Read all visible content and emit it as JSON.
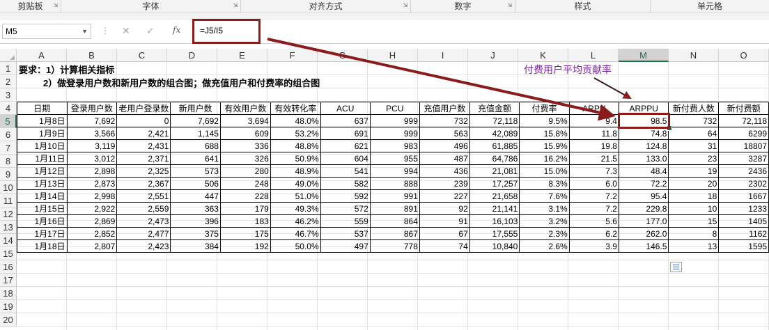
{
  "ribbon": {
    "groups": [
      "剪贴板",
      "字体",
      "对齐方式",
      "数字",
      "样式",
      "单元格"
    ]
  },
  "formula_bar": {
    "name_box": "M5",
    "fx_label": "fx",
    "formula": "=J5/I5"
  },
  "columns": [
    "A",
    "B",
    "C",
    "D",
    "E",
    "F",
    "G",
    "H",
    "I",
    "J",
    "K",
    "L",
    "M",
    "N",
    "O"
  ],
  "selected_column": "M",
  "rows": [
    "1",
    "2",
    "3",
    "4",
    "5",
    "6",
    "7",
    "8",
    "9",
    "10",
    "11",
    "12",
    "13",
    "14",
    "15",
    "16",
    "17",
    "18",
    "19",
    "20"
  ],
  "selected_row": "5",
  "sheet": {
    "line1": "要求：1）计算相关指标",
    "line2": "2）做登录用户数和新用户数的组合图；做充值用户和付费率的组合图",
    "headers": [
      "日期",
      "登录用户数",
      "老用户登录数",
      "新用户数",
      "有效用户数",
      "有效转化率",
      "ACU",
      "PCU",
      "充值用户数",
      "充值金额",
      "付费率",
      "ARPU",
      "ARPPU",
      "新付费人数",
      "新付费额"
    ],
    "rows": [
      [
        "1月8日",
        "7,692",
        "0",
        "7,692",
        "3,694",
        "48.0%",
        "637",
        "999",
        "732",
        "72,118",
        "9.5%",
        "9.4",
        "98.5",
        "732",
        "72,118"
      ],
      [
        "1月9日",
        "3,566",
        "2,421",
        "1,145",
        "609",
        "53.2%",
        "691",
        "999",
        "563",
        "42,089",
        "15.8%",
        "11.8",
        "74.8",
        "64",
        "6299"
      ],
      [
        "1月10日",
        "3,119",
        "2,431",
        "688",
        "336",
        "48.8%",
        "621",
        "983",
        "496",
        "61,885",
        "15.9%",
        "19.8",
        "124.8",
        "31",
        "18807"
      ],
      [
        "1月11日",
        "3,012",
        "2,371",
        "641",
        "326",
        "50.9%",
        "604",
        "955",
        "487",
        "64,786",
        "16.2%",
        "21.5",
        "133.0",
        "23",
        "3287"
      ],
      [
        "1月12日",
        "2,898",
        "2,325",
        "573",
        "280",
        "48.9%",
        "541",
        "994",
        "436",
        "21,081",
        "15.0%",
        "7.3",
        "48.4",
        "19",
        "2436"
      ],
      [
        "1月13日",
        "2,873",
        "2,367",
        "506",
        "248",
        "49.0%",
        "582",
        "888",
        "239",
        "17,257",
        "8.3%",
        "6.0",
        "72.2",
        "20",
        "2302"
      ],
      [
        "1月14日",
        "2,998",
        "2,551",
        "447",
        "228",
        "51.0%",
        "592",
        "991",
        "227",
        "21,658",
        "7.6%",
        "7.2",
        "95.4",
        "18",
        "1667"
      ],
      [
        "1月15日",
        "2,922",
        "2,559",
        "363",
        "179",
        "49.3%",
        "572",
        "891",
        "92",
        "21,141",
        "3.1%",
        "7.2",
        "229.8",
        "10",
        "1233"
      ],
      [
        "1月16日",
        "2,869",
        "2,473",
        "396",
        "183",
        "46.2%",
        "559",
        "864",
        "91",
        "16,103",
        "3.2%",
        "5.6",
        "177.0",
        "15",
        "1405"
      ],
      [
        "1月17日",
        "2,852",
        "2,477",
        "375",
        "175",
        "46.7%",
        "537",
        "867",
        "67",
        "17,555",
        "2.3%",
        "6.2",
        "262.0",
        "8",
        "1162"
      ],
      [
        "1月18日",
        "2,807",
        "2,423",
        "384",
        "192",
        "50.0%",
        "497",
        "778",
        "74",
        "10,840",
        "2.6%",
        "3.9",
        "146.5",
        "13",
        "1595"
      ]
    ]
  },
  "annotation": "付费用户平均贡献率",
  "colors": {
    "accent_green": "#217346",
    "annotation_purple": "#7b1fa2",
    "highlight_red": "#8b1c1c"
  }
}
